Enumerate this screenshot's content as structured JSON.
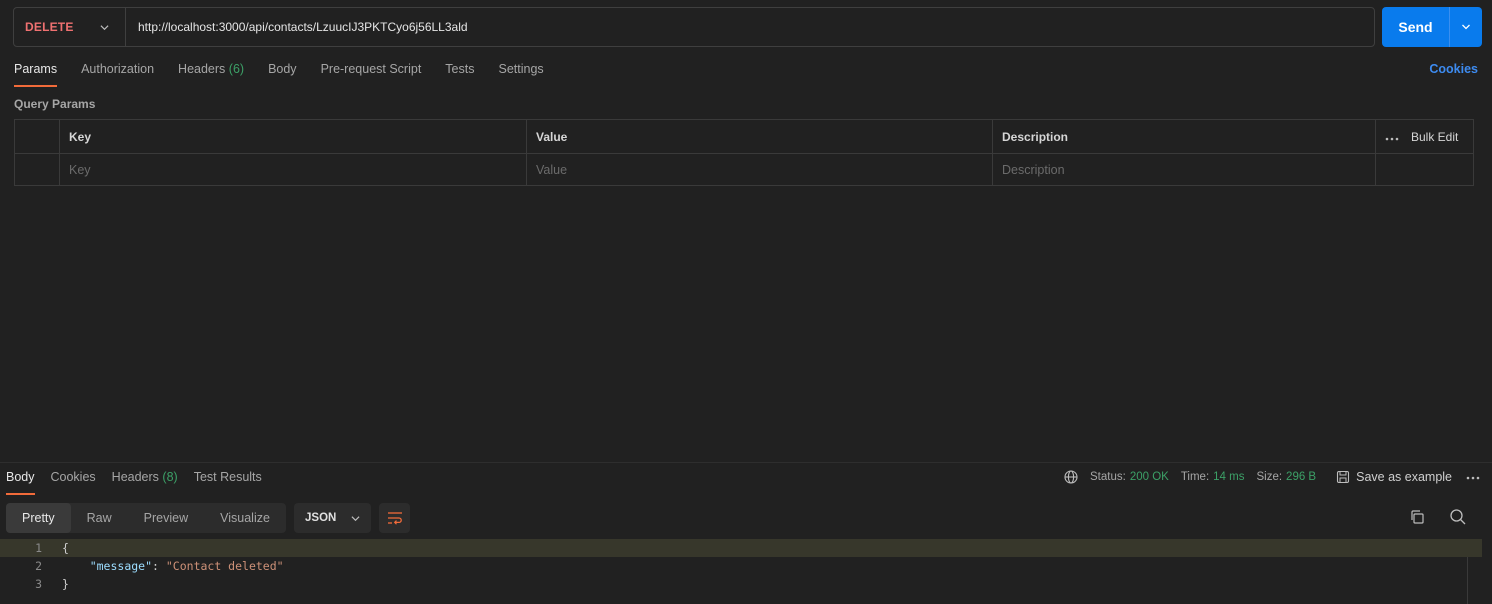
{
  "request": {
    "method": "DELETE",
    "url": "http://localhost:3000/api/contacts/LzuucIJ3PKTCyo6j56LL3ald",
    "send_label": "Send"
  },
  "request_tabs": [
    {
      "label": "Params",
      "count": ""
    },
    {
      "label": "Authorization",
      "count": ""
    },
    {
      "label": "Headers",
      "count": "(6)"
    },
    {
      "label": "Body",
      "count": ""
    },
    {
      "label": "Pre-request Script",
      "count": ""
    },
    {
      "label": "Tests",
      "count": ""
    },
    {
      "label": "Settings",
      "count": ""
    }
  ],
  "cookies_label": "Cookies",
  "query_params": {
    "title": "Query Params",
    "columns": [
      "Key",
      "Value",
      "Description"
    ],
    "bulk_edit": "Bulk Edit",
    "placeholders": {
      "key": "Key",
      "value": "Value",
      "description": "Description"
    }
  },
  "response_tabs": [
    {
      "label": "Body",
      "count": ""
    },
    {
      "label": "Cookies",
      "count": ""
    },
    {
      "label": "Headers",
      "count": "(8)"
    },
    {
      "label": "Test Results",
      "count": ""
    }
  ],
  "response_meta": {
    "status_label": "Status:",
    "status_value": "200 OK",
    "time_label": "Time:",
    "time_value": "14 ms",
    "size_label": "Size:",
    "size_value": "296 B",
    "save_example": "Save as example"
  },
  "view_modes": [
    "Pretty",
    "Raw",
    "Preview",
    "Visualize"
  ],
  "format": "JSON",
  "code_lines": [
    {
      "num": "1",
      "text": "{"
    },
    {
      "num": "2",
      "key": "\"message\"",
      "sep": ": ",
      "value": "\"Contact deleted\""
    },
    {
      "num": "3",
      "text": "}"
    }
  ],
  "colors": {
    "method": "#f07171",
    "accent": "#f26b3a",
    "send": "#097bed",
    "success": "#3ca067",
    "link": "#3d8bf0"
  }
}
